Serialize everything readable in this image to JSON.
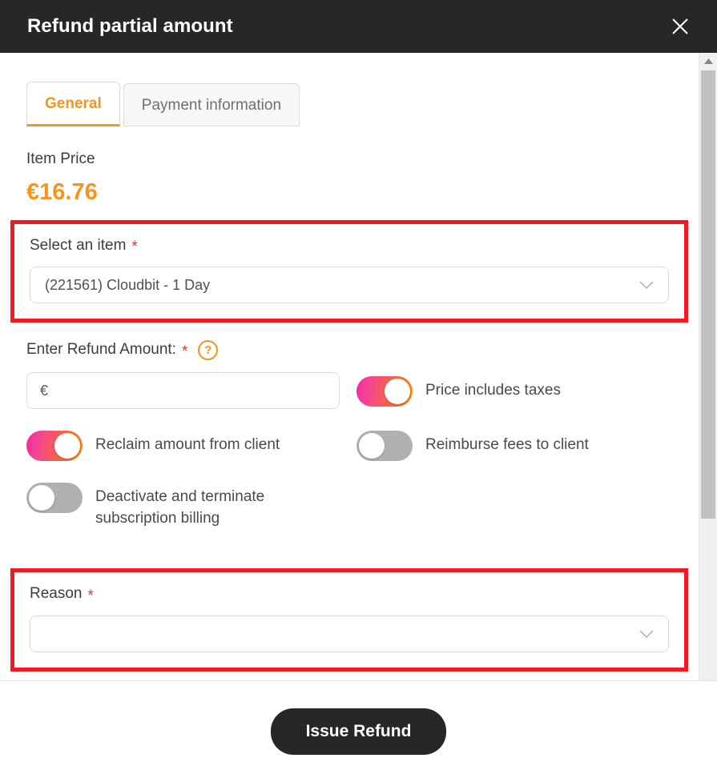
{
  "header": {
    "title": "Refund partial amount",
    "close_label": "×"
  },
  "tabs": [
    {
      "label": "General",
      "active": true
    },
    {
      "label": "Payment information",
      "active": false
    }
  ],
  "item_price": {
    "label": "Item Price",
    "value": "€16.76"
  },
  "select_item": {
    "label": "Select an item",
    "required_marker": "*",
    "value": "(221561) Cloudbit - 1 Day"
  },
  "refund_amount": {
    "label": "Enter Refund Amount:",
    "required_marker": "*",
    "help_glyph": "?",
    "value": "",
    "placeholder": "€"
  },
  "toggles": [
    {
      "label": "Price includes taxes",
      "state": "on"
    },
    {
      "label": "Reclaim amount from client",
      "state": "on"
    },
    {
      "label": "Reimburse fees to client",
      "state": "off"
    },
    {
      "label": "Deactivate and terminate subscription billing",
      "state": "off"
    }
  ],
  "reason": {
    "label": "Reason",
    "required_marker": "*",
    "value": ""
  },
  "footer": {
    "submit_label": "Issue Refund"
  },
  "colors": {
    "header_bg": "#272727",
    "accent_orange": "#f7941d",
    "required_red": "#e8372c",
    "highlight_red": "#ed1c24",
    "toggle_on_from": "#f2239a",
    "toggle_on_to": "#f7941d",
    "toggle_off": "#b0b0b0",
    "button_bg": "#272727"
  }
}
